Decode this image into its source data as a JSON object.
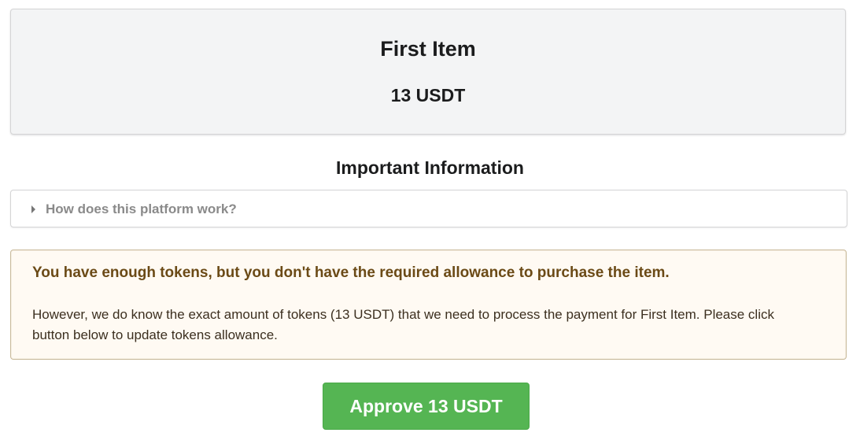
{
  "item": {
    "title": "First Item",
    "price": "13 USDT"
  },
  "info": {
    "heading": "Important Information",
    "accordion_label": "How does this platform work?"
  },
  "warning": {
    "header": "You have enough tokens, but you don't have the required allowance to purchase the item.",
    "body": "However, we do know the exact amount of tokens (13 USDT) that we need to process the payment for First Item. Please click button below to update tokens allowance."
  },
  "actions": {
    "approve_label": "Approve 13 USDT"
  },
  "colors": {
    "approve_button": "#55b553",
    "warning_background": "#fffaf3",
    "warning_text": "#573a08",
    "card_background": "#f3f4f5"
  },
  "icons": {
    "accordion": "caret-right-icon"
  }
}
